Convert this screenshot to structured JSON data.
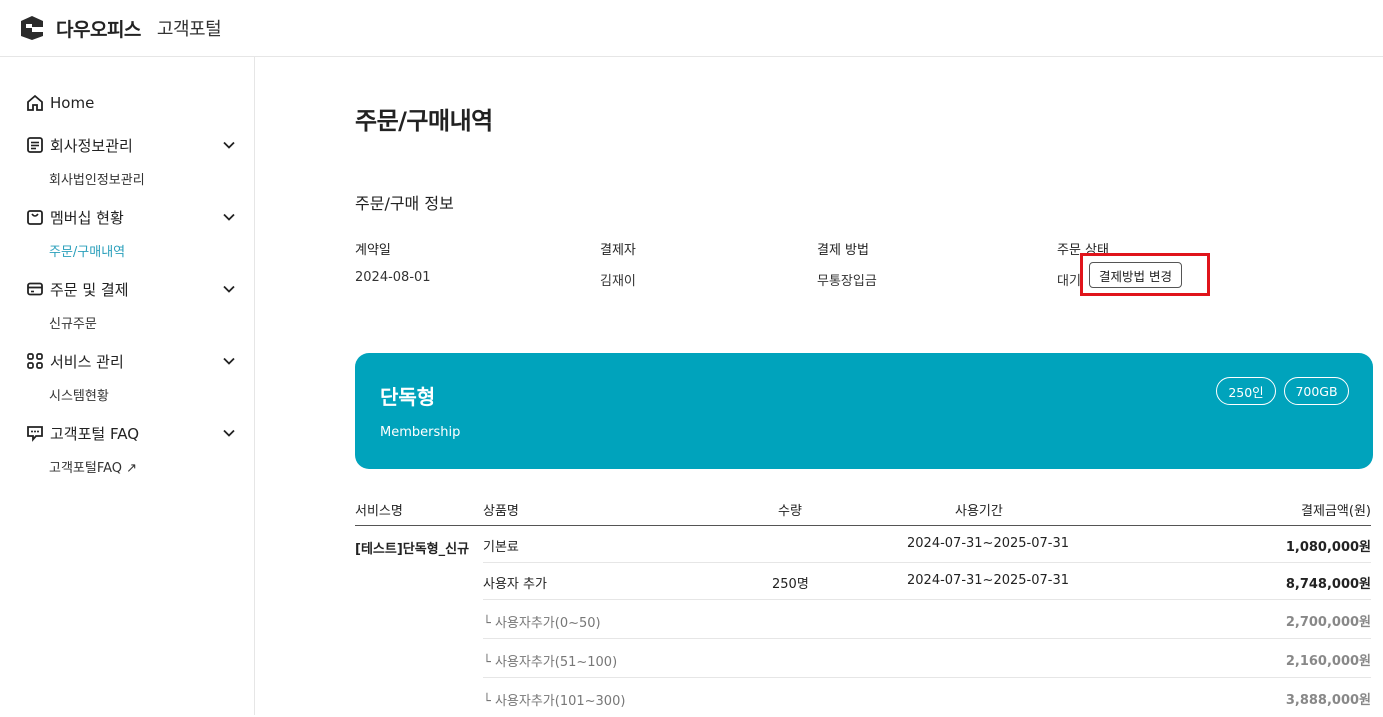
{
  "header": {
    "brand": "다우오피스",
    "portal": "고객포털"
  },
  "sidebar": {
    "home": "Home",
    "groups": [
      {
        "label": "회사정보관리",
        "sub": "회사법인정보관리"
      },
      {
        "label": "멤버십 현황",
        "sub": "주문/구매내역"
      },
      {
        "label": "주문 및 결제",
        "sub": "신규주문"
      },
      {
        "label": "서비스 관리",
        "sub": "시스템현황"
      },
      {
        "label": "고객포털 FAQ",
        "sub": "고객포털FAQ ↗"
      }
    ],
    "active_sub": "주문/구매내역"
  },
  "page": {
    "title": "주문/구매내역",
    "section_title": "주문/구매 정보",
    "info": {
      "contract_date_label": "계약일",
      "contract_date": "2024-08-01",
      "payer_label": "결제자",
      "payer": "김재이",
      "method_label": "결제 방법",
      "method": "무통장입금",
      "status_label": "주문 상태",
      "status": "대기"
    },
    "change_button": "결제방법 변경"
  },
  "card": {
    "title": "단독형",
    "subtitle": "Membership",
    "badges": [
      "250인",
      "700GB"
    ],
    "color": "#00a3bc"
  },
  "table": {
    "headers": [
      "서비스명",
      "상품명",
      "수량",
      "사용기간",
      "결제금액(원)"
    ],
    "service_name": "[테스트]단독형_신규",
    "rows": [
      {
        "product": "기본료",
        "qty": "",
        "period": "2024-07-31~2025-07-31",
        "amount": "1,080,000원",
        "sub": false
      },
      {
        "product": "사용자 추가",
        "qty": "250명",
        "period": "2024-07-31~2025-07-31",
        "amount": "8,748,000원",
        "sub": false
      },
      {
        "product": "└  사용자추가(0~50)",
        "qty": "",
        "period": "",
        "amount": "2,700,000원",
        "sub": true
      },
      {
        "product": "└  사용자추가(51~100)",
        "qty": "",
        "period": "",
        "amount": "2,160,000원",
        "sub": true
      },
      {
        "product": "└  사용자추가(101~300)",
        "qty": "",
        "period": "",
        "amount": "3,888,000원",
        "sub": true
      }
    ]
  }
}
